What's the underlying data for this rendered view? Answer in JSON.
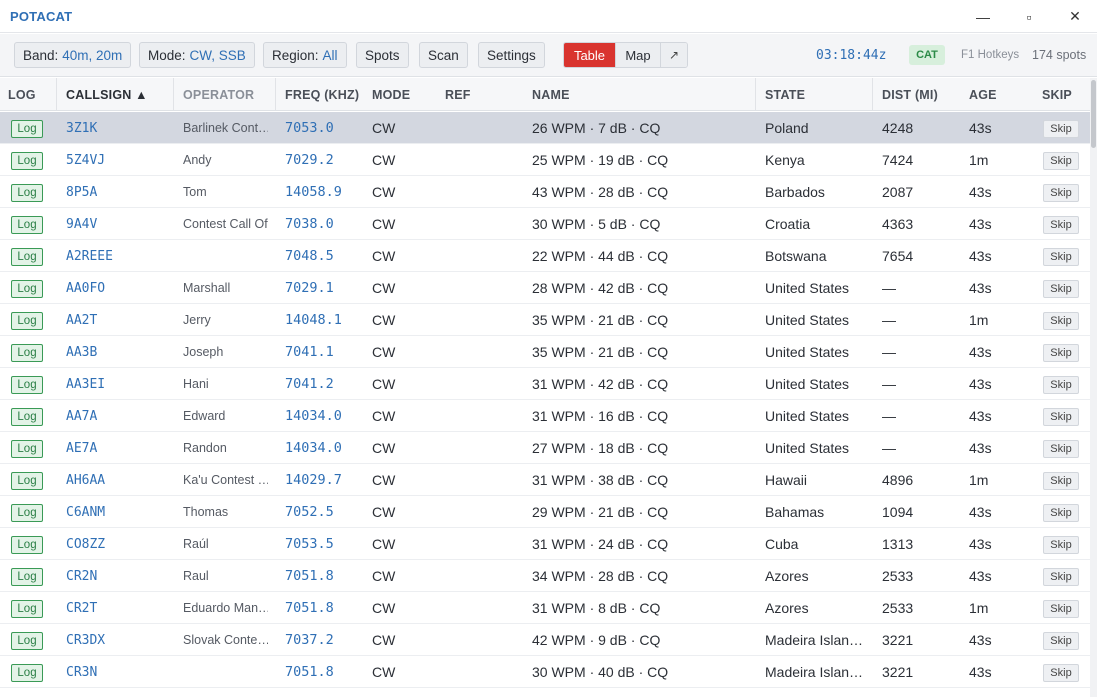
{
  "app": {
    "title": "POTACAT"
  },
  "window": {
    "minimize": "—",
    "maximize": "▫",
    "close": "✕"
  },
  "toolbar": {
    "band_label": "Band:",
    "band_value": "40m, 20m",
    "mode_label": "Mode:",
    "mode_value": "CW, SSB",
    "region_label": "Region:",
    "region_value": "All",
    "spots_label": "Spots",
    "scan_label": "Scan",
    "settings_label": "Settings",
    "view_table": "Table",
    "view_map": "Map",
    "popout_icon": "↗",
    "clock": "03:18:44z",
    "cat_status": "CAT",
    "hotkeys_hint": "F1 Hotkeys",
    "spots_count": "174 spots"
  },
  "table": {
    "headers": {
      "log": "LOG",
      "callsign": "CALLSIGN ▲",
      "operator": "OPERATOR",
      "freq": "FREQ (KHZ)",
      "mode": "MODE",
      "ref": "REF",
      "name": "NAME",
      "state": "STATE",
      "dist": "DIST (MI)",
      "age": "AGE",
      "skip": "SKIP"
    },
    "rows": [
      {
        "log": "Log",
        "callsign": "3Z1K",
        "operator": "Barlinek Cont…",
        "freq": "7053.0",
        "mode": "CW",
        "ref": "",
        "name": "26 WPM · 7 dB · CQ",
        "state": "Poland",
        "dist": "4248",
        "age": "43s",
        "skip": "Skip",
        "selected": true
      },
      {
        "log": "Log",
        "callsign": "5Z4VJ",
        "operator": "Andy",
        "freq": "7029.2",
        "mode": "CW",
        "ref": "",
        "name": "25 WPM · 19 dB · CQ",
        "state": "Kenya",
        "dist": "7424",
        "age": "1m",
        "skip": "Skip"
      },
      {
        "log": "Log",
        "callsign": "8P5A",
        "operator": "Tom",
        "freq": "14058.9",
        "mode": "CW",
        "ref": "",
        "name": "43 WPM · 28 dB · CQ",
        "state": "Barbados",
        "dist": "2087",
        "age": "43s",
        "skip": "Skip"
      },
      {
        "log": "Log",
        "callsign": "9A4V",
        "operator": "Contest Call Of",
        "freq": "7038.0",
        "mode": "CW",
        "ref": "",
        "name": "30 WPM · 5 dB · CQ",
        "state": "Croatia",
        "dist": "4363",
        "age": "43s",
        "skip": "Skip"
      },
      {
        "log": "Log",
        "callsign": "A2REEE",
        "operator": "",
        "freq": "7048.5",
        "mode": "CW",
        "ref": "",
        "name": "22 WPM · 44 dB · CQ",
        "state": "Botswana",
        "dist": "7654",
        "age": "43s",
        "skip": "Skip"
      },
      {
        "log": "Log",
        "callsign": "AA0FO",
        "operator": "Marshall",
        "freq": "7029.1",
        "mode": "CW",
        "ref": "",
        "name": "28 WPM · 42 dB · CQ",
        "state": "United States",
        "dist": "—",
        "age": "43s",
        "skip": "Skip"
      },
      {
        "log": "Log",
        "callsign": "AA2T",
        "operator": "Jerry",
        "freq": "14048.1",
        "mode": "CW",
        "ref": "",
        "name": "35 WPM · 21 dB · CQ",
        "state": "United States",
        "dist": "—",
        "age": "1m",
        "skip": "Skip"
      },
      {
        "log": "Log",
        "callsign": "AA3B",
        "operator": "Joseph",
        "freq": "7041.1",
        "mode": "CW",
        "ref": "",
        "name": "35 WPM · 21 dB · CQ",
        "state": "United States",
        "dist": "—",
        "age": "43s",
        "skip": "Skip"
      },
      {
        "log": "Log",
        "callsign": "AA3EI",
        "operator": "Hani",
        "freq": "7041.2",
        "mode": "CW",
        "ref": "",
        "name": "31 WPM · 42 dB · CQ",
        "state": "United States",
        "dist": "—",
        "age": "43s",
        "skip": "Skip"
      },
      {
        "log": "Log",
        "callsign": "AA7A",
        "operator": "Edward",
        "freq": "14034.0",
        "mode": "CW",
        "ref": "",
        "name": "31 WPM · 16 dB · CQ",
        "state": "United States",
        "dist": "—",
        "age": "43s",
        "skip": "Skip"
      },
      {
        "log": "Log",
        "callsign": "AE7A",
        "operator": "Randon",
        "freq": "14034.0",
        "mode": "CW",
        "ref": "",
        "name": "27 WPM · 18 dB · CQ",
        "state": "United States",
        "dist": "—",
        "age": "43s",
        "skip": "Skip"
      },
      {
        "log": "Log",
        "callsign": "AH6AA",
        "operator": "Ka'u Contest …",
        "freq": "14029.7",
        "mode": "CW",
        "ref": "",
        "name": "31 WPM · 38 dB · CQ",
        "state": "Hawaii",
        "dist": "4896",
        "age": "1m",
        "skip": "Skip"
      },
      {
        "log": "Log",
        "callsign": "C6ANM",
        "operator": "Thomas",
        "freq": "7052.5",
        "mode": "CW",
        "ref": "",
        "name": "29 WPM · 21 dB · CQ",
        "state": "Bahamas",
        "dist": "1094",
        "age": "43s",
        "skip": "Skip"
      },
      {
        "log": "Log",
        "callsign": "CO8ZZ",
        "operator": "Raúl",
        "freq": "7053.5",
        "mode": "CW",
        "ref": "",
        "name": "31 WPM · 24 dB · CQ",
        "state": "Cuba",
        "dist": "1313",
        "age": "43s",
        "skip": "Skip"
      },
      {
        "log": "Log",
        "callsign": "CR2N",
        "operator": "Raul",
        "freq": "7051.8",
        "mode": "CW",
        "ref": "",
        "name": "34 WPM · 28 dB · CQ",
        "state": "Azores",
        "dist": "2533",
        "age": "43s",
        "skip": "Skip"
      },
      {
        "log": "Log",
        "callsign": "CR2T",
        "operator": "Eduardo Man…",
        "freq": "7051.8",
        "mode": "CW",
        "ref": "",
        "name": "31 WPM · 8 dB · CQ",
        "state": "Azores",
        "dist": "2533",
        "age": "1m",
        "skip": "Skip"
      },
      {
        "log": "Log",
        "callsign": "CR3DX",
        "operator": "Slovak Conte…",
        "freq": "7037.2",
        "mode": "CW",
        "ref": "",
        "name": "42 WPM · 9 dB · CQ",
        "state": "Madeira Islan…",
        "dist": "3221",
        "age": "43s",
        "skip": "Skip"
      },
      {
        "log": "Log",
        "callsign": "CR3N",
        "operator": "",
        "freq": "7051.8",
        "mode": "CW",
        "ref": "",
        "name": "30 WPM · 40 dB · CQ",
        "state": "Madeira Islan…",
        "dist": "3221",
        "age": "43s",
        "skip": "Skip"
      }
    ]
  }
}
